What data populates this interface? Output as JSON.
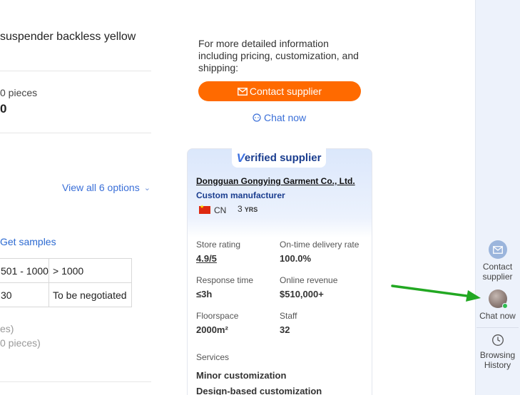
{
  "product": {
    "title_fragment": "suspender backless yellow",
    "pieces_fragment": "0 pieces",
    "price_fragment": "0",
    "view_all_options": "View all 6 options",
    "get_samples": "Get samples"
  },
  "quantity_table": {
    "rows": [
      [
        "501 - 1000",
        "> 1000"
      ],
      [
        "30",
        "To be negotiated"
      ]
    ]
  },
  "notes": {
    "line1": "es)",
    "line2": "0 pieces)"
  },
  "inquiry": {
    "info_text": "For more detailed information including pricing, customization, and shipping:",
    "contact_button": "Contact supplier",
    "chat_now": "Chat now"
  },
  "supplier": {
    "badge_v": "V",
    "badge_rest": "erified supplier",
    "company_name": "Dongguan Gongying Garment Co., Ltd.",
    "type": "Custom manufacturer",
    "country": "CN",
    "years_number": "3",
    "years_unit": "YRS",
    "stats": [
      {
        "label": "Store rating",
        "value": "4.9/5"
      },
      {
        "label": "On-time delivery rate",
        "value": "100.0%"
      },
      {
        "label": "Response time",
        "value": "≤3h"
      },
      {
        "label": "Online revenue",
        "value": "$510,000+"
      },
      {
        "label": "Floorspace",
        "value": "2000m²"
      },
      {
        "label": "Staff",
        "value": "32"
      }
    ],
    "services_label": "Services",
    "services": [
      "Minor customization",
      "Design-based customization"
    ]
  },
  "sidebar": {
    "contact_line1": "Contact",
    "contact_line2": "supplier",
    "chat_now": "Chat now",
    "history_line1": "Browsing",
    "history_line2": "History"
  },
  "colors": {
    "accent_orange": "#ff6a00",
    "link_blue": "#3a6fd8",
    "verified_navy": "#1a3d8f",
    "online_green": "#2fbd4f",
    "arrow_green": "#22a822"
  }
}
